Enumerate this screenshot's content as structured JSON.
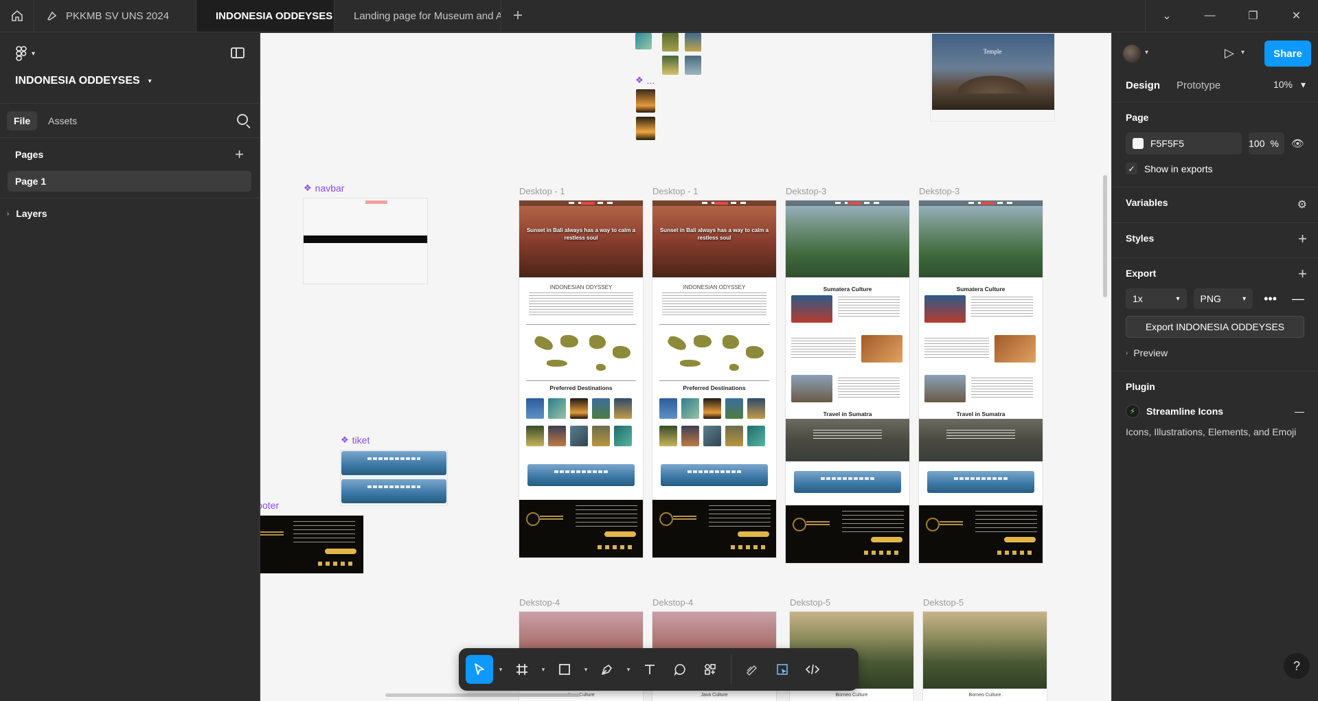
{
  "tabs": [
    {
      "label": "PKKMB SV UNS 2024",
      "active": false
    },
    {
      "label": "INDONESIA ODDEYSES",
      "active": true
    },
    {
      "label": "Landing page for Museum and Art Co",
      "active": false
    }
  ],
  "left_panel": {
    "file_title": "INDONESIA ODDEYSES",
    "tabs": [
      "File",
      "Assets"
    ],
    "pages_heading": "Pages",
    "pages": [
      "Page 1"
    ],
    "layers_heading": "Layers"
  },
  "canvas": {
    "component_labels": {
      "navbar": "navbar",
      "tiket": "tiket",
      "footer": "Footer",
      "top_dots": "..."
    },
    "frames_row1": [
      "Desktop - 1",
      "Desktop - 1",
      "Dekstop-3",
      "Dekstop-3"
    ],
    "frames_row2": [
      "Dekstop-4",
      "Dekstop-4",
      "Dekstop-5",
      "Dekstop-5"
    ],
    "temple_title": "Temple",
    "hero_text": "Sunset in Bali always has a way to calm a restless soul",
    "odyssey_title": "INDONESIAN ODYSSEY",
    "preferred_destinations": "Preferred Destinations",
    "sumatera_culture": "Sumatera Culture",
    "travel_in_sumatra": "Travel in Sumatra",
    "java_culture": "Java Culture",
    "borneo_culture": "Borneo Culture",
    "footer_brand": "INDONESIAN ODYSSEY"
  },
  "right_panel": {
    "share_label": "Share",
    "modes": [
      "Design",
      "Prototype"
    ],
    "zoom": "10%",
    "page_heading": "Page",
    "page_color": "F5F5F5",
    "page_opacity": "100",
    "percent": "%",
    "show_in_exports": "Show in exports",
    "variables": "Variables",
    "styles": "Styles",
    "export_heading": "Export",
    "export_scale": "1x",
    "export_format": "PNG",
    "export_button": "Export INDONESIA ODDEYSES",
    "preview": "Preview",
    "plugin_heading": "Plugin",
    "plugin_name": "Streamline Icons",
    "plugin_desc": "Icons, Illustrations, Elements, and Emoji"
  },
  "icons": {
    "home": "home-icon",
    "tab_file": "file-icon",
    "add_tab": "plus-icon",
    "minimize": "minimize-icon",
    "restore": "restore-icon",
    "close": "close-icon",
    "chevron": "chevron-down-icon"
  },
  "colors": {
    "accent": "#0d99ff",
    "component": "#8a4cf0",
    "canvas_bg": "#f5f5f5",
    "panel_bg": "#2c2c2c"
  }
}
